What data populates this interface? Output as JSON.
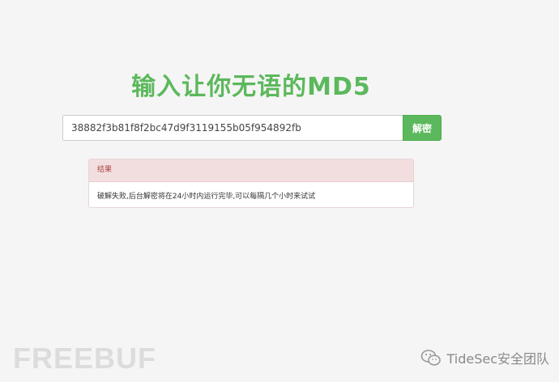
{
  "page": {
    "title": "输入让你无语的MD5"
  },
  "search": {
    "input_value": "38882f3b81f8f2bc47d9f3119155b05f954892fb",
    "button_label": "解密"
  },
  "result": {
    "heading": "结果",
    "message": "破解失败,后台解密将在24小时内运行完毕,可以每隔几个小时来试试"
  },
  "watermark": {
    "logo_text": "FREEBUF",
    "account_name": "TideSec安全团队"
  },
  "colors": {
    "accent": "#5cb85c",
    "danger_text": "#a94442",
    "danger_bg": "#f2dede",
    "page_bg": "#f5f5f5"
  },
  "icons": {
    "watermark_icon": "wechat-icon"
  }
}
